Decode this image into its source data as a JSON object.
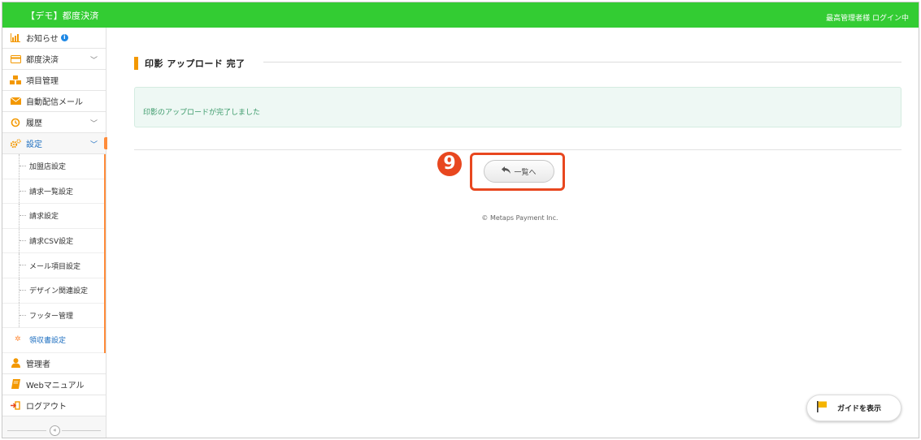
{
  "header": {
    "app_title": "【デモ】都度決済",
    "login_status": "最高管理者様 ログイン中"
  },
  "sidebar": {
    "items": [
      {
        "label": "お知らせ",
        "icon": "bar-chart-icon",
        "badge": "i"
      },
      {
        "label": "都度決済",
        "icon": "credit-card-icon",
        "chevron": "﹀"
      },
      {
        "label": "項目管理",
        "icon": "cubes-icon"
      },
      {
        "label": "自動配信メール",
        "icon": "envelope-icon"
      },
      {
        "label": "履歴",
        "icon": "history-icon",
        "chevron": "﹀"
      },
      {
        "label": "設定",
        "icon": "gears-icon",
        "chevron": "﹀"
      }
    ],
    "sub_items": [
      {
        "label": "加盟店設定"
      },
      {
        "label": "請求一覧設定"
      },
      {
        "label": "請求設定"
      },
      {
        "label": "請求CSV設定"
      },
      {
        "label": "メール項目設定"
      },
      {
        "label": "デザイン関連設定"
      },
      {
        "label": "フッター管理"
      },
      {
        "label": "領収書設定"
      }
    ],
    "bottom_items": [
      {
        "label": "管理者",
        "icon": "user-icon"
      },
      {
        "label": "Webマニュアル",
        "icon": "book-icon"
      },
      {
        "label": "ログアウト",
        "icon": "sign-out-icon"
      }
    ],
    "collapse_symbol": "«"
  },
  "main": {
    "section_title": "印影 アップロード 完了",
    "notice_message": "印影のアップロードが完了しました",
    "back_button_label": "一覧へ",
    "step_number": "9",
    "copyright": "© Metaps Payment Inc.",
    "guide_button_label": "ガイドを表示"
  },
  "colors": {
    "header_green": "#33cc33",
    "accent_orange": "#f39800",
    "highlight_red": "#e8471f",
    "active_blue": "#1e6fc0"
  }
}
